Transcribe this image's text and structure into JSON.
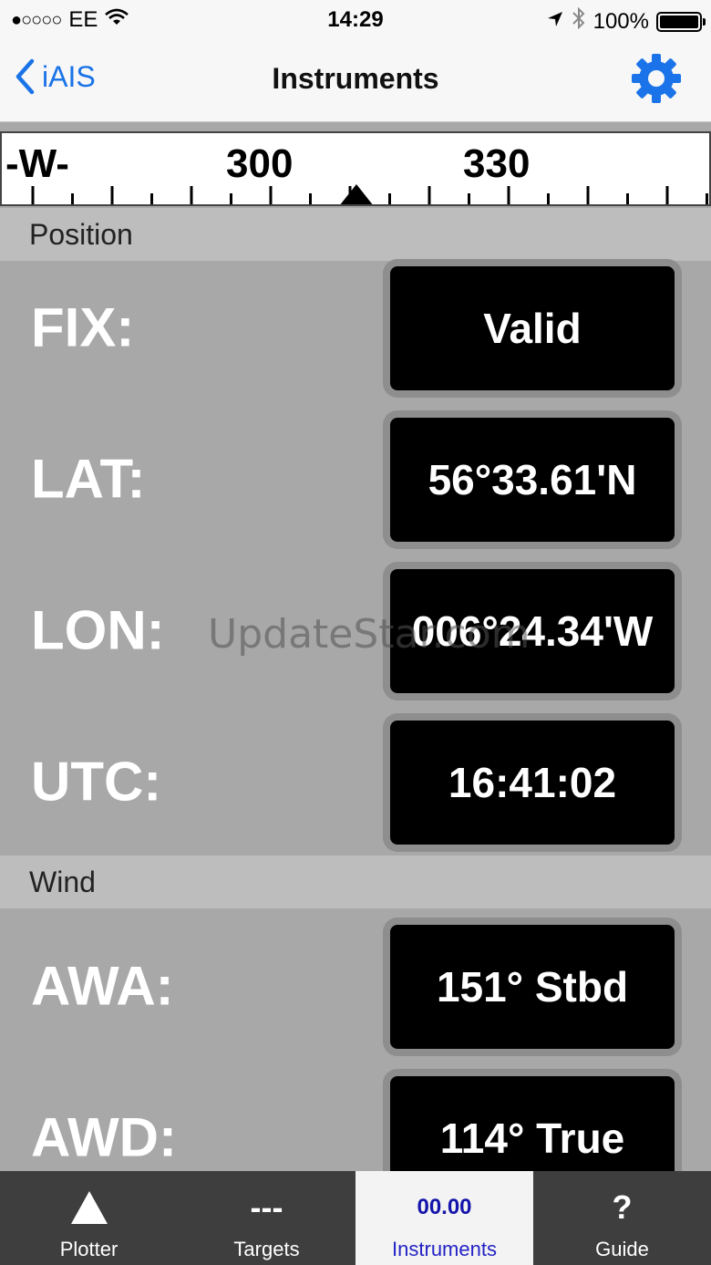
{
  "status_bar": {
    "carrier": "EE",
    "signal": "●○○○○",
    "time": "14:29",
    "battery": "100%"
  },
  "nav": {
    "back_label": "iAIS",
    "title": "Instruments"
  },
  "compass": {
    "labels": [
      "-W-",
      "300",
      "330"
    ]
  },
  "sections": {
    "position": "Position",
    "wind": "Wind"
  },
  "position_rows": [
    {
      "label": "FIX:",
      "value": "Valid"
    },
    {
      "label": "LAT:",
      "value": "56°33.61'N"
    },
    {
      "label": "LON:",
      "value": "006°24.34'W"
    },
    {
      "label": "UTC:",
      "value": "16:41:02"
    }
  ],
  "wind_rows": [
    {
      "label": "AWA:",
      "value": "151° Stbd"
    },
    {
      "label": "AWD:",
      "value": "114° True"
    }
  ],
  "watermark": "UpdateStar.com",
  "tabs": [
    {
      "label": "Plotter",
      "icon": "triangle-icon"
    },
    {
      "label": "Targets",
      "icon_text": "---"
    },
    {
      "label": "Instruments",
      "icon_text": "00.00"
    },
    {
      "label": "Guide",
      "icon_text": "?"
    }
  ],
  "colors": {
    "accent": "#1a73e8",
    "active_tab": "#2323c6"
  }
}
